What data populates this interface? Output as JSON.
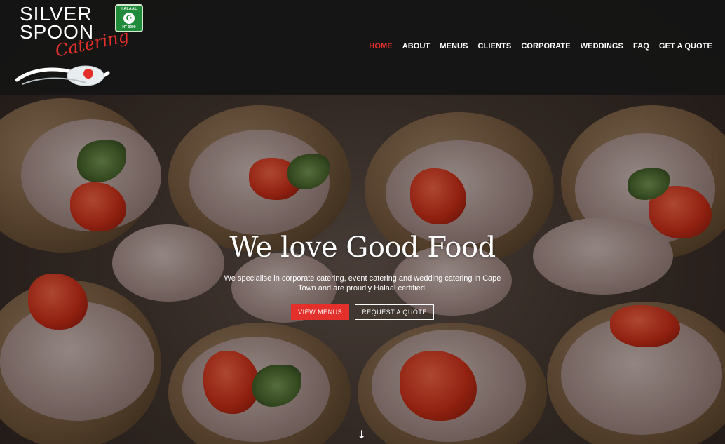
{
  "brand": {
    "line1": "SILVER",
    "line2": "SPOON",
    "script": "Catering",
    "halaal_label": "HALAAL",
    "halaal_code": "HT 0000"
  },
  "nav": {
    "items": [
      {
        "label": "HOME",
        "active": true
      },
      {
        "label": "ABOUT"
      },
      {
        "label": "MENUS"
      },
      {
        "label": "CLIENTS"
      },
      {
        "label": "CORPORATE"
      },
      {
        "label": "WEDDINGS"
      },
      {
        "label": "FAQ"
      },
      {
        "label": "GET A QUOTE"
      }
    ]
  },
  "hero": {
    "title": "We love Good Food",
    "subtitle": "We specialise in corporate catering, event catering and wedding catering in Cape Town and are proudly Halaal certified.",
    "primary_button": "VIEW MENUS",
    "secondary_button": "REQUEST A QUOTE",
    "scroll_icon": "↓"
  },
  "colors": {
    "accent": "#e4302b",
    "header_bg": "#141414",
    "text": "#ffffff"
  },
  "icons": {
    "scroll": "arrow-down-icon",
    "certification": "halaal-badge-icon"
  }
}
